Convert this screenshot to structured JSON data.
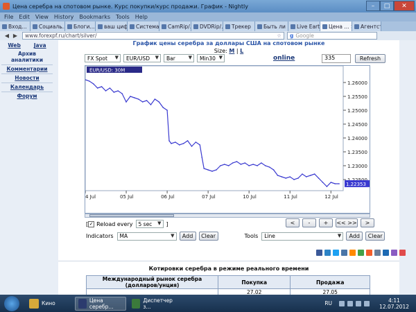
{
  "window": {
    "title": "Цена серебра на спотовом рынке. Курс покупки/курс продажи. График - Nightly",
    "minimize": "–",
    "maximize": "□",
    "close": "✕"
  },
  "menu": [
    "File",
    "Edit",
    "View",
    "History",
    "Bookmarks",
    "Tools",
    "Help"
  ],
  "tabs": [
    {
      "label": "Вход...",
      "active": false
    },
    {
      "label": "Социаль...",
      "active": false
    },
    {
      "label": "Блоги...",
      "active": false
    },
    {
      "label": "ваш циф...",
      "active": false
    },
    {
      "label": "Система...",
      "active": false
    },
    {
      "label": "CamRip/...",
      "active": false
    },
    {
      "label": "DVDRip/...",
      "active": false
    },
    {
      "label": "Трекер",
      "active": false
    },
    {
      "label": "Быть ли ...",
      "active": false
    },
    {
      "label": "Live Eart...",
      "active": false
    },
    {
      "label": "Цена ...",
      "active": true
    },
    {
      "label": "Агентств...",
      "active": false
    }
  ],
  "address": {
    "url": "www.forexpf.ru/chart/silver/",
    "search_placeholder": "Google"
  },
  "leftnav": {
    "web": "Web",
    "java": "Java",
    "archive": "Архив аналитики",
    "comments": "Комментарии",
    "news": "Новости",
    "calendar": "Календарь",
    "forum": "Форум"
  },
  "page": {
    "title": "График цены серебра за доллары США на спотовом рынке",
    "size_label": "Size:",
    "size_m": "M",
    "size_sep": "|",
    "size_l": "L"
  },
  "controls": {
    "source": "FX Spot",
    "pair": "EUR/USD",
    "chart_type": "Bar",
    "interval": "Min30",
    "online": "online",
    "bars_count": "335",
    "refresh": "Refresh",
    "reload_label": "Reload every",
    "reload_checked": "✓",
    "reload_interval": "5 sec",
    "nav_prev": "<",
    "nav_minus": "-",
    "nav_plus": "+",
    "nav_expand": "<< >>",
    "nav_next": ">",
    "indicators_label": "Indicators",
    "indicator_value": "MA",
    "add": "Add",
    "clear": "Clear",
    "tools_label": "Tools",
    "tool_value": "Line"
  },
  "chart_data": {
    "type": "line",
    "title": "EUR/USD: 30M",
    "x_labels": [
      "4 Jul",
      "05 Jul",
      "06 Jul",
      "07 Jul",
      "10 Jul",
      "11 Jul",
      "12 Jul"
    ],
    "x_label_positions": [
      0,
      1,
      2,
      3,
      4,
      5,
      6
    ],
    "y_ticks": [
      "1.26000",
      "1.25500",
      "1.25000",
      "1.24500",
      "1.24000",
      "1.23500",
      "1.23000",
      "1.22500"
    ],
    "ylim": [
      1.221,
      1.264
    ],
    "last_value": "1.22353",
    "line_color": "#3a3ad0",
    "series": [
      {
        "x": [
          0.0,
          0.1,
          0.2,
          0.3,
          0.4,
          0.5,
          0.6,
          0.7,
          0.8,
          0.9,
          1.0,
          1.1,
          1.2,
          1.3,
          1.4,
          1.5,
          1.6,
          1.7,
          1.8,
          1.9,
          2.0,
          2.05,
          2.1,
          2.2,
          2.3,
          2.4,
          2.5,
          2.6,
          2.7,
          2.8,
          2.85,
          2.9,
          3.0,
          3.1,
          3.2,
          3.3,
          3.4,
          3.5,
          3.6,
          3.7,
          3.8,
          3.9,
          4.0,
          4.1,
          4.2,
          4.3,
          4.4,
          4.5,
          4.6,
          4.7,
          4.8,
          4.9,
          5.0,
          5.1,
          5.2,
          5.3,
          5.4,
          5.5,
          5.6,
          5.7,
          5.8,
          5.9,
          6.0,
          6.1,
          6.2
        ],
        "y": [
          1.261,
          1.2605,
          1.2595,
          1.258,
          1.2585,
          1.257,
          1.258,
          1.2565,
          1.257,
          1.256,
          1.253,
          1.255,
          1.2545,
          1.254,
          1.253,
          1.2535,
          1.252,
          1.254,
          1.253,
          1.251,
          1.25,
          1.239,
          1.238,
          1.2385,
          1.2375,
          1.238,
          1.239,
          1.237,
          1.2385,
          1.2375,
          1.233,
          1.229,
          1.2285,
          1.228,
          1.2285,
          1.23,
          1.2305,
          1.23,
          1.231,
          1.2315,
          1.2305,
          1.231,
          1.23,
          1.2305,
          1.23,
          1.231,
          1.23,
          1.2295,
          1.2285,
          1.2265,
          1.226,
          1.2255,
          1.226,
          1.225,
          1.2255,
          1.227,
          1.226,
          1.2265,
          1.227,
          1.2255,
          1.224,
          1.2225,
          1.224,
          1.2235,
          1.2235
        ]
      }
    ]
  },
  "share_colors": [
    "#3b5998",
    "#2c83c6",
    "#1da1f2",
    "#4a76a8",
    "#ff8a00",
    "#45a248",
    "#f55f2b",
    "#6a7f9a",
    "#1e6ab3",
    "#8a5cc2",
    "#e04b4b"
  ],
  "quotes": {
    "title": "Котировки серебра в режиме реального времени",
    "col_market": "Международный рынок серебра (долларов/унция)",
    "col_buy": "Покупка",
    "col_sell": "Продажа",
    "buy": "27.02",
    "sell": "27.05"
  },
  "taskbar": {
    "tasks": [
      {
        "label": "Кино",
        "active": false,
        "color": "#d6a93a"
      },
      {
        "label": "Цена серебр...",
        "active": true,
        "color": "#2b3b6e"
      },
      {
        "label": "Диспетчер з...",
        "active": false,
        "color": "#3b7a3b"
      }
    ],
    "lang": "RU",
    "time": "4:11",
    "date": "12.07.2012"
  }
}
